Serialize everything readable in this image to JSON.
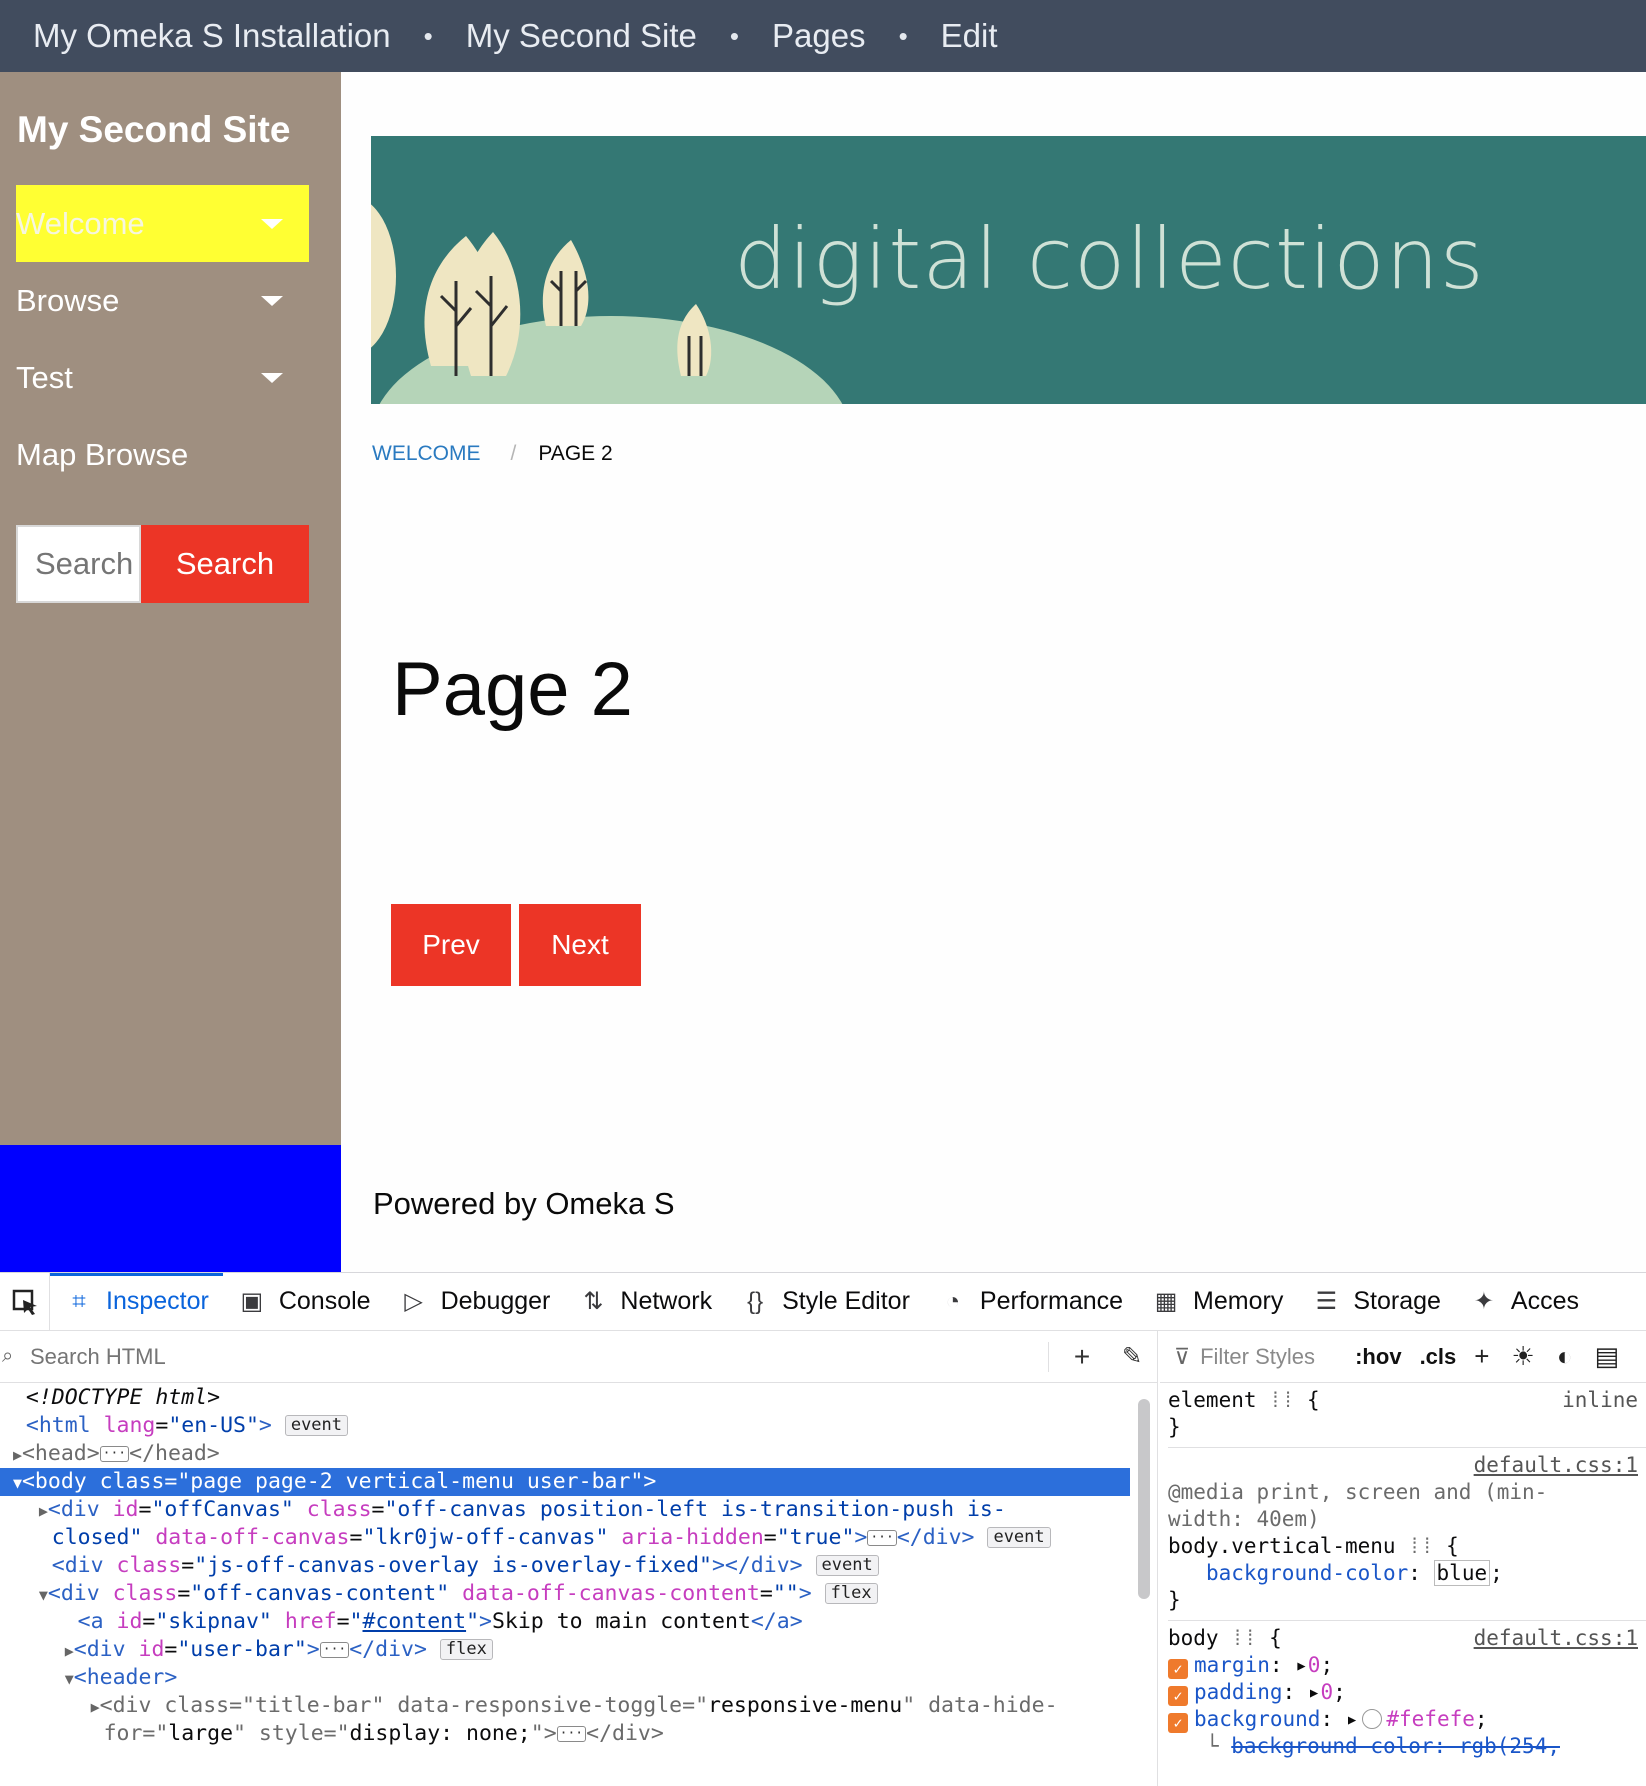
{
  "user_bar": {
    "crumbs": [
      "My Omeka S Installation",
      "My Second Site",
      "Pages",
      "Edit"
    ],
    "separator": "•"
  },
  "sidebar": {
    "site_title": "My Second Site",
    "nav": [
      {
        "label": "Welcome",
        "has_submenu": true,
        "active": true
      },
      {
        "label": "Browse",
        "has_submenu": true,
        "active": false
      },
      {
        "label": "Test",
        "has_submenu": true,
        "active": false
      },
      {
        "label": "Map Browse",
        "has_submenu": false,
        "active": false
      }
    ],
    "search": {
      "placeholder": "Search",
      "button_label": "Search"
    }
  },
  "banner": {
    "text": "digital collections"
  },
  "breadcrumb": {
    "parent": "Welcome",
    "separator": "/",
    "current": "Page 2"
  },
  "page": {
    "title": "Page 2",
    "prev_label": "Prev",
    "next_label": "Next"
  },
  "footer": {
    "text": "Powered by Omeka S"
  },
  "colors": {
    "user_bar": "#414c5e",
    "sidebar": "#9f8f80",
    "sidebar_bottom": "#0000ff",
    "active_nav": "#ffff33",
    "button": "#ec3526",
    "banner": "#347874",
    "devtools_selection": "#2c6fdb"
  },
  "devtools": {
    "tabs": [
      {
        "label": "Inspector",
        "icon": "inspector-icon",
        "glyph": "⌗"
      },
      {
        "label": "Console",
        "icon": "console-icon",
        "glyph": "▣"
      },
      {
        "label": "Debugger",
        "icon": "debugger-icon",
        "glyph": "▷"
      },
      {
        "label": "Network",
        "icon": "network-icon",
        "glyph": "⇅"
      },
      {
        "label": "Style Editor",
        "icon": "style-editor-icon",
        "glyph": "{}"
      },
      {
        "label": "Performance",
        "icon": "performance-icon",
        "glyph": "◔"
      },
      {
        "label": "Memory",
        "icon": "memory-icon",
        "glyph": "▦"
      },
      {
        "label": "Storage",
        "icon": "storage-icon",
        "glyph": "☰"
      },
      {
        "label": "Acces",
        "icon": "accessibility-icon",
        "glyph": "✦"
      }
    ],
    "search_html_placeholder": "Search HTML",
    "filter_styles_placeholder": "Filter Styles",
    "hov_label": ":hov",
    "cls_label": ".cls",
    "badges": {
      "event": "event",
      "flex": "flex"
    },
    "rules": {
      "element_selector": "element",
      "inline_label": "inline",
      "source_1": "default.css:1",
      "media_query": "@media print, screen and (min-width: 40em)",
      "rule_selector": "body.vertical-menu",
      "rule_prop": "background-color",
      "rule_value": "blue",
      "body_selector": "body",
      "source_2": "default.css:1",
      "body_props": [
        {
          "name": "margin",
          "value": "0"
        },
        {
          "name": "padding",
          "value": "0"
        },
        {
          "name": "background",
          "value": "#fefefe"
        }
      ],
      "overridden": "background-color: rgb(254,"
    }
  }
}
